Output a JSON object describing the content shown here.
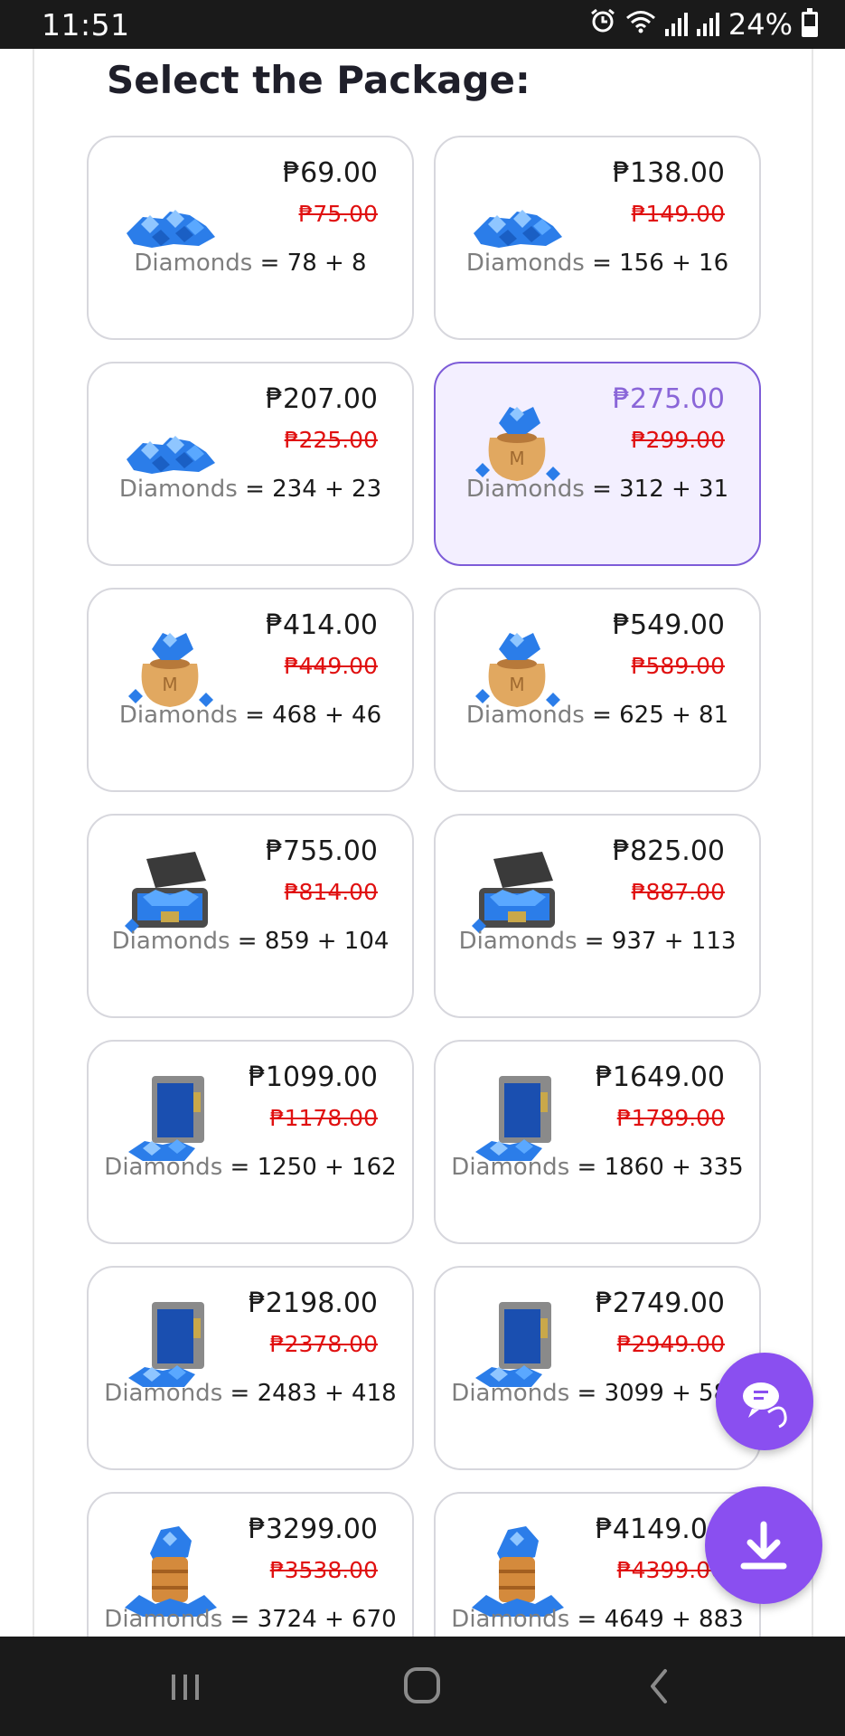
{
  "status_bar": {
    "time": "11:51",
    "battery": "24%"
  },
  "page": {
    "heading": "Select the Package:"
  },
  "packages": [
    {
      "icon": "diamond-pile-icon",
      "price": "₱69.00",
      "old_price": "₱75.00",
      "label": "Diamonds",
      "amount": "= 78 + 8",
      "selected": false
    },
    {
      "icon": "diamond-pile-icon",
      "price": "₱138.00",
      "old_price": "₱149.00",
      "label": "Diamonds",
      "amount": "= 156 + 16",
      "selected": false
    },
    {
      "icon": "diamond-pile-icon",
      "price": "₱207.00",
      "old_price": "₱225.00",
      "label": "Diamonds",
      "amount": "= 234 + 23",
      "selected": false
    },
    {
      "icon": "diamond-bag-icon",
      "price": "₱275.00",
      "old_price": "₱299.00",
      "label": "Diamonds",
      "amount": "= 312 + 31",
      "selected": true
    },
    {
      "icon": "diamond-bag-icon",
      "price": "₱414.00",
      "old_price": "₱449.00",
      "label": "Diamonds",
      "amount": "= 468 + 46",
      "selected": false
    },
    {
      "icon": "diamond-bag-icon",
      "price": "₱549.00",
      "old_price": "₱589.00",
      "label": "Diamonds",
      "amount": "= 625 + 81",
      "selected": false
    },
    {
      "icon": "diamond-chest-icon",
      "price": "₱755.00",
      "old_price": "₱814.00",
      "label": "Diamonds",
      "amount": "= 859 + 104",
      "selected": false
    },
    {
      "icon": "diamond-chest-icon",
      "price": "₱825.00",
      "old_price": "₱887.00",
      "label": "Diamonds",
      "amount": "= 937 + 113",
      "selected": false
    },
    {
      "icon": "diamond-safe-icon",
      "price": "₱1099.00",
      "old_price": "₱1178.00",
      "label": "Diamonds",
      "amount": "= 1250 + 162",
      "selected": false
    },
    {
      "icon": "diamond-safe-icon",
      "price": "₱1649.00",
      "old_price": "₱1789.00",
      "label": "Diamonds",
      "amount": "= 1860 + 335",
      "selected": false
    },
    {
      "icon": "diamond-safe-icon",
      "price": "₱2198.00",
      "old_price": "₱2378.00",
      "label": "Diamonds",
      "amount": "= 2483 + 418",
      "selected": false
    },
    {
      "icon": "diamond-safe-icon",
      "price": "₱2749.00",
      "old_price": "₱2949.00",
      "label": "Diamonds",
      "amount": "= 3099 + 589",
      "selected": false
    },
    {
      "icon": "diamond-barrel-icon",
      "price": "₱3299.00",
      "old_price": "₱3538.00",
      "label": "Diamonds",
      "amount": "= 3724 + 670",
      "selected": false
    },
    {
      "icon": "diamond-barrel-icon",
      "price": "₱4149.00",
      "old_price": "₱4399.00",
      "label": "Diamonds",
      "amount": "= 4649 + 883",
      "selected": false
    }
  ],
  "colors": {
    "accent": "#8a4ff0",
    "selected_bg": "#f3efff",
    "selected_border": "#7d5cd8",
    "old_price": "#e01010",
    "selected_price": "#8a66d8"
  },
  "fabs": {
    "chat_icon": "chat-bubble-icon",
    "download_icon": "download-icon"
  },
  "nav": {
    "recent_icon": "recent-apps-icon",
    "home_icon": "home-icon",
    "back_icon": "back-icon"
  }
}
